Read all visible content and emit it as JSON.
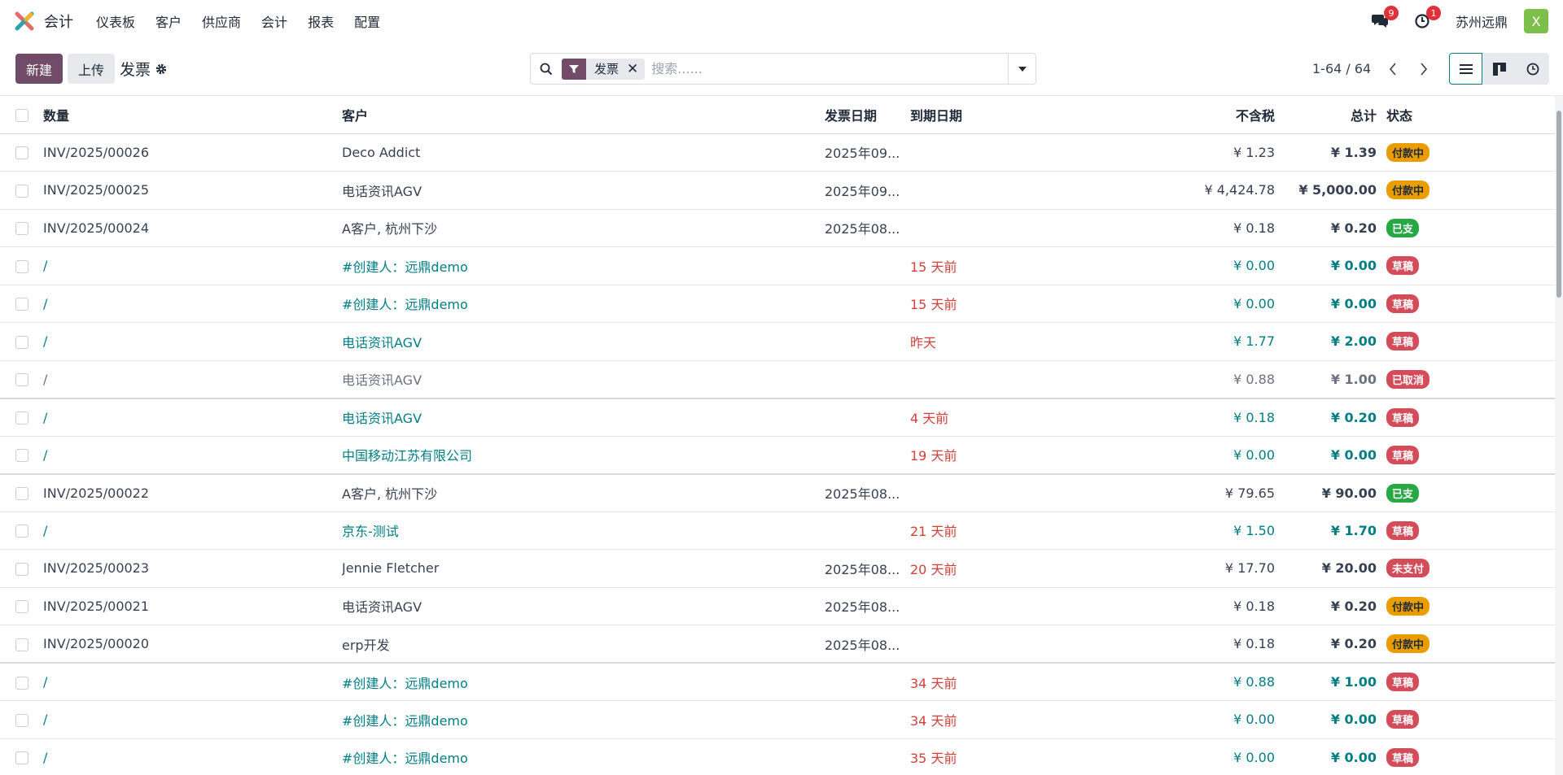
{
  "navbar": {
    "app_name": "会计",
    "menu": [
      "仪表板",
      "客户",
      "供应商",
      "会计",
      "报表",
      "配置"
    ],
    "messages_count": "9",
    "activities_count": "1",
    "company": "苏州远鼎",
    "avatar_letter": "X"
  },
  "control": {
    "new_label": "新建",
    "upload_label": "上传",
    "breadcrumb": "发票",
    "search": {
      "facet": "发票",
      "placeholder": "搜索......"
    },
    "pager": "1-64 / 64"
  },
  "table": {
    "headers": {
      "number": "数量",
      "customer": "客户",
      "invoice_date": "发票日期",
      "due_date": "到期日期",
      "untaxed": "不含税",
      "total": "总计",
      "status": "状态"
    },
    "rows": [
      {
        "number": "INV/2025/00026",
        "customer": "Deco Addict",
        "invoice_date": "2025年09...",
        "due_date": "",
        "untaxed": "¥ 1.23",
        "total": "¥ 1.39",
        "status": "付款中",
        "kind": "posted",
        "tag": "paying"
      },
      {
        "number": "INV/2025/00025",
        "customer": "电话资讯AGV",
        "invoice_date": "2025年09...",
        "due_date": "",
        "untaxed": "¥ 4,424.78",
        "total": "¥ 5,000.00",
        "status": "付款中",
        "kind": "posted",
        "tag": "paying"
      },
      {
        "number": "INV/2025/00024",
        "customer": "A客户, 杭州下沙",
        "invoice_date": "2025年08...",
        "due_date": "",
        "untaxed": "¥ 0.18",
        "total": "¥ 0.20",
        "status": "已支",
        "kind": "posted",
        "tag": "paid"
      },
      {
        "number": "/",
        "customer": "#创建人：远鼎demo",
        "invoice_date": "",
        "due_date": "15 天前",
        "untaxed": "¥ 0.00",
        "total": "¥ 0.00",
        "status": "草稿",
        "kind": "draft",
        "tag": "draft"
      },
      {
        "number": "/",
        "customer": "#创建人：远鼎demo",
        "invoice_date": "",
        "due_date": "15 天前",
        "untaxed": "¥ 0.00",
        "total": "¥ 0.00",
        "status": "草稿",
        "kind": "draft",
        "tag": "draft"
      },
      {
        "number": "/",
        "customer": "电话资讯AGV",
        "invoice_date": "",
        "due_date": "昨天",
        "untaxed": "¥ 1.77",
        "total": "¥ 2.00",
        "status": "草稿",
        "kind": "draft",
        "tag": "draft"
      },
      {
        "number": "/",
        "customer": "电话资讯AGV",
        "invoice_date": "",
        "due_date": "",
        "untaxed": "¥ 0.88",
        "total": "¥ 1.00",
        "status": "已取消",
        "kind": "cancelled",
        "tag": "cancel",
        "sep": true
      },
      {
        "number": "/",
        "customer": "电话资讯AGV",
        "invoice_date": "",
        "due_date": "4 天前",
        "untaxed": "¥ 0.18",
        "total": "¥ 0.20",
        "status": "草稿",
        "kind": "draft",
        "tag": "draft"
      },
      {
        "number": "/",
        "customer": "中国移动江苏有限公司",
        "invoice_date": "",
        "due_date": "19 天前",
        "untaxed": "¥ 0.00",
        "total": "¥ 0.00",
        "status": "草稿",
        "kind": "draft",
        "tag": "draft",
        "sep": true
      },
      {
        "number": "INV/2025/00022",
        "customer": "A客户, 杭州下沙",
        "invoice_date": "2025年08...",
        "due_date": "",
        "untaxed": "¥ 79.65",
        "total": "¥ 90.00",
        "status": "已支",
        "kind": "posted",
        "tag": "paid"
      },
      {
        "number": "/",
        "customer": "京东-测试",
        "invoice_date": "",
        "due_date": "21 天前",
        "untaxed": "¥ 1.50",
        "total": "¥ 1.70",
        "status": "草稿",
        "kind": "draft",
        "tag": "draft"
      },
      {
        "number": "INV/2025/00023",
        "customer": "Jennie Fletcher",
        "invoice_date": "2025年08...",
        "due_date": "20 天前",
        "untaxed": "¥ 17.70",
        "total": "¥ 20.00",
        "status": "未支付",
        "kind": "posted",
        "tag": "unpaid"
      },
      {
        "number": "INV/2025/00021",
        "customer": "电话资讯AGV",
        "invoice_date": "2025年08...",
        "due_date": "",
        "untaxed": "¥ 0.18",
        "total": "¥ 0.20",
        "status": "付款中",
        "kind": "posted",
        "tag": "paying"
      },
      {
        "number": "INV/2025/00020",
        "customer": "erp开发",
        "invoice_date": "2025年08...",
        "due_date": "",
        "untaxed": "¥ 0.18",
        "total": "¥ 0.20",
        "status": "付款中",
        "kind": "posted",
        "tag": "paying",
        "sep": true
      },
      {
        "number": "/",
        "customer": "#创建人：远鼎demo",
        "invoice_date": "",
        "due_date": "34 天前",
        "untaxed": "¥ 0.88",
        "total": "¥ 1.00",
        "status": "草稿",
        "kind": "draft",
        "tag": "draft"
      },
      {
        "number": "/",
        "customer": "#创建人：远鼎demo",
        "invoice_date": "",
        "due_date": "34 天前",
        "untaxed": "¥ 0.00",
        "total": "¥ 0.00",
        "status": "草稿",
        "kind": "draft",
        "tag": "draft"
      },
      {
        "number": "/",
        "customer": "#创建人：远鼎demo",
        "invoice_date": "",
        "due_date": "35 天前",
        "untaxed": "¥ 0.00",
        "total": "¥ 0.00",
        "status": "草稿",
        "kind": "draft",
        "tag": "draft"
      }
    ]
  }
}
